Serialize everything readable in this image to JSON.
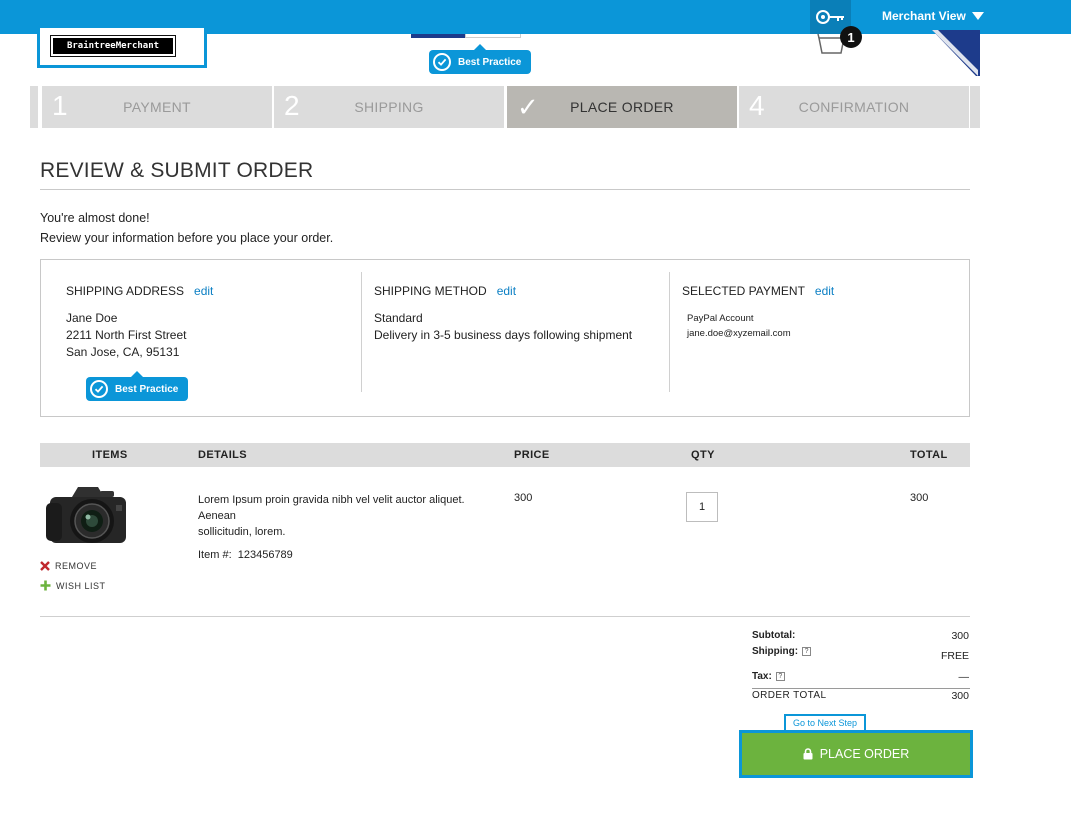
{
  "topbar": {
    "merchant_view_label": "Merchant View"
  },
  "header": {
    "logo_text": "BraintreeMerchant",
    "cart_count": "1",
    "best_practice_label": "Best Practice"
  },
  "steps": [
    {
      "number": "1",
      "label": "PAYMENT",
      "state": "inactive"
    },
    {
      "number": "2",
      "label": "SHIPPING",
      "state": "inactive"
    },
    {
      "number": "✓",
      "label": "PLACE ORDER",
      "state": "active"
    },
    {
      "number": "4",
      "label": "CONFIRMATION",
      "state": "inactive"
    }
  ],
  "main": {
    "title": "REVIEW & SUBMIT ORDER",
    "intro_line1": "You're almost done!",
    "intro_line2": "Review your information before you place your order."
  },
  "shipping_address": {
    "heading": "SHIPPING ADDRESS",
    "edit_label": "edit",
    "name": "Jane Doe",
    "street": "2211 North First Street",
    "city_line": "San Jose, CA, 95131",
    "best_practice_label": "Best Practice"
  },
  "shipping_method": {
    "heading": "SHIPPING METHOD",
    "edit_label": "edit",
    "method": "Standard",
    "detail": "Delivery in 3-5 business days following shipment"
  },
  "selected_payment": {
    "heading": "SELECTED PAYMENT",
    "edit_label": "edit",
    "type": "PayPal Account",
    "email": "jane.doe@xyzemail.com"
  },
  "table": {
    "columns": [
      "ITEMS",
      "DETAILS",
      "PRICE",
      "QTY",
      "TOTAL"
    ],
    "rows": [
      {
        "description_line1": "Lorem Ipsum proin gravida nibh vel velit auctor aliquet. Aenean",
        "description_line2": "sollicitudin, lorem.",
        "item_number": "Item #:  123456789",
        "price": "300",
        "qty": "1",
        "total": "300",
        "remove_label": "REMOVE",
        "wishlist_label": "WISH LIST"
      }
    ]
  },
  "summary": {
    "subtotal_label": "Subtotal:",
    "subtotal_value": "300",
    "shipping_label": "Shipping:",
    "shipping_value": "FREE",
    "tax_label": "Tax:",
    "tax_value": "—",
    "help_glyph": "?",
    "order_total_label": "ORDER TOTAL",
    "order_total_value": "300"
  },
  "actions": {
    "next_step_label": "Go to Next Step",
    "place_order_label": "PLACE ORDER"
  },
  "colors": {
    "brand_blue": "#0b96d8",
    "place_order_green": "#6cb33e",
    "step_active": "#b9b7b2",
    "step_inactive": "#dcdcdc",
    "link_blue": "#0b7fc4",
    "remove_red": "#c0282d",
    "wishlist_green": "#6cb33e"
  },
  "icons": [
    "key-icon",
    "caret-down-icon",
    "cart-icon",
    "checkmark-circle-icon",
    "camera-image",
    "remove-x-icon",
    "plus-icon",
    "lock-icon",
    "help-icon"
  ]
}
